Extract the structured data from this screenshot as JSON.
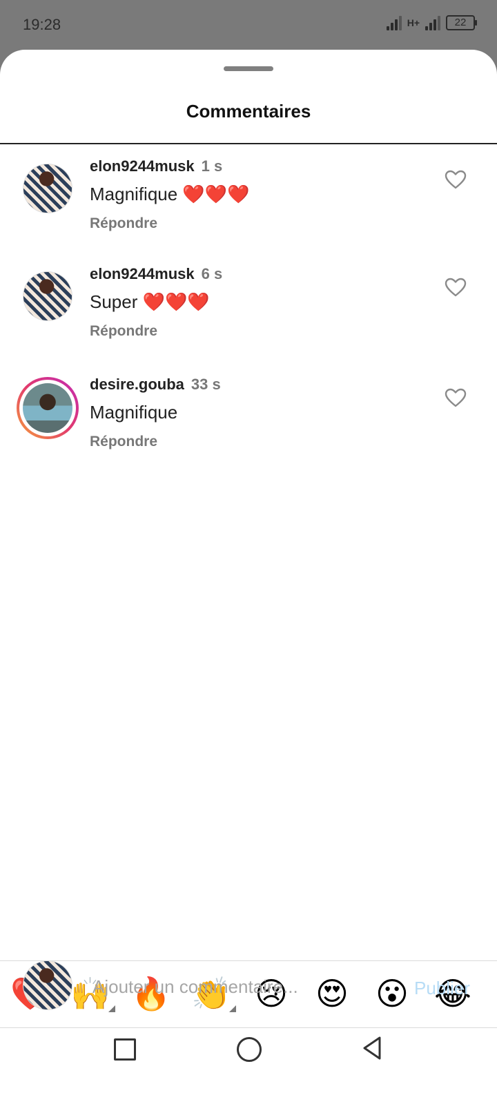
{
  "status_bar": {
    "time": "19:28",
    "network": "H+",
    "battery": "22"
  },
  "sheet": {
    "title": "Commentaires"
  },
  "comments": [
    {
      "username": "elon9244musk",
      "time": "1 s",
      "text": "Magnifique ❤️❤️❤️",
      "reply": "Répondre",
      "avatar": "profile-photo",
      "liked": false
    },
    {
      "username": "elon9244musk",
      "time": "6 s",
      "text": "Super ❤️❤️❤️",
      "reply": "Répondre",
      "avatar": "profile-photo",
      "liked": false
    },
    {
      "username": "desire.gouba",
      "time": "33 s",
      "text": "Magnifique",
      "reply": "Répondre",
      "avatar": "profile-photo-story-ring",
      "liked": false
    }
  ],
  "emoji_bar": [
    "❤️",
    "🙌",
    "🔥",
    "👏",
    "😢",
    "😍",
    "😮",
    "😂"
  ],
  "composer": {
    "placeholder": "Ajouter un commentaire...",
    "publish_label": "Publier"
  },
  "colors": {
    "publish_disabled": "#b7dcf6",
    "story_ring_start": "#f6a13a",
    "story_ring_end": "#c12bb5"
  },
  "icons": [
    "heart-outline-icon",
    "recent-apps-icon",
    "home-icon",
    "back-icon"
  ]
}
